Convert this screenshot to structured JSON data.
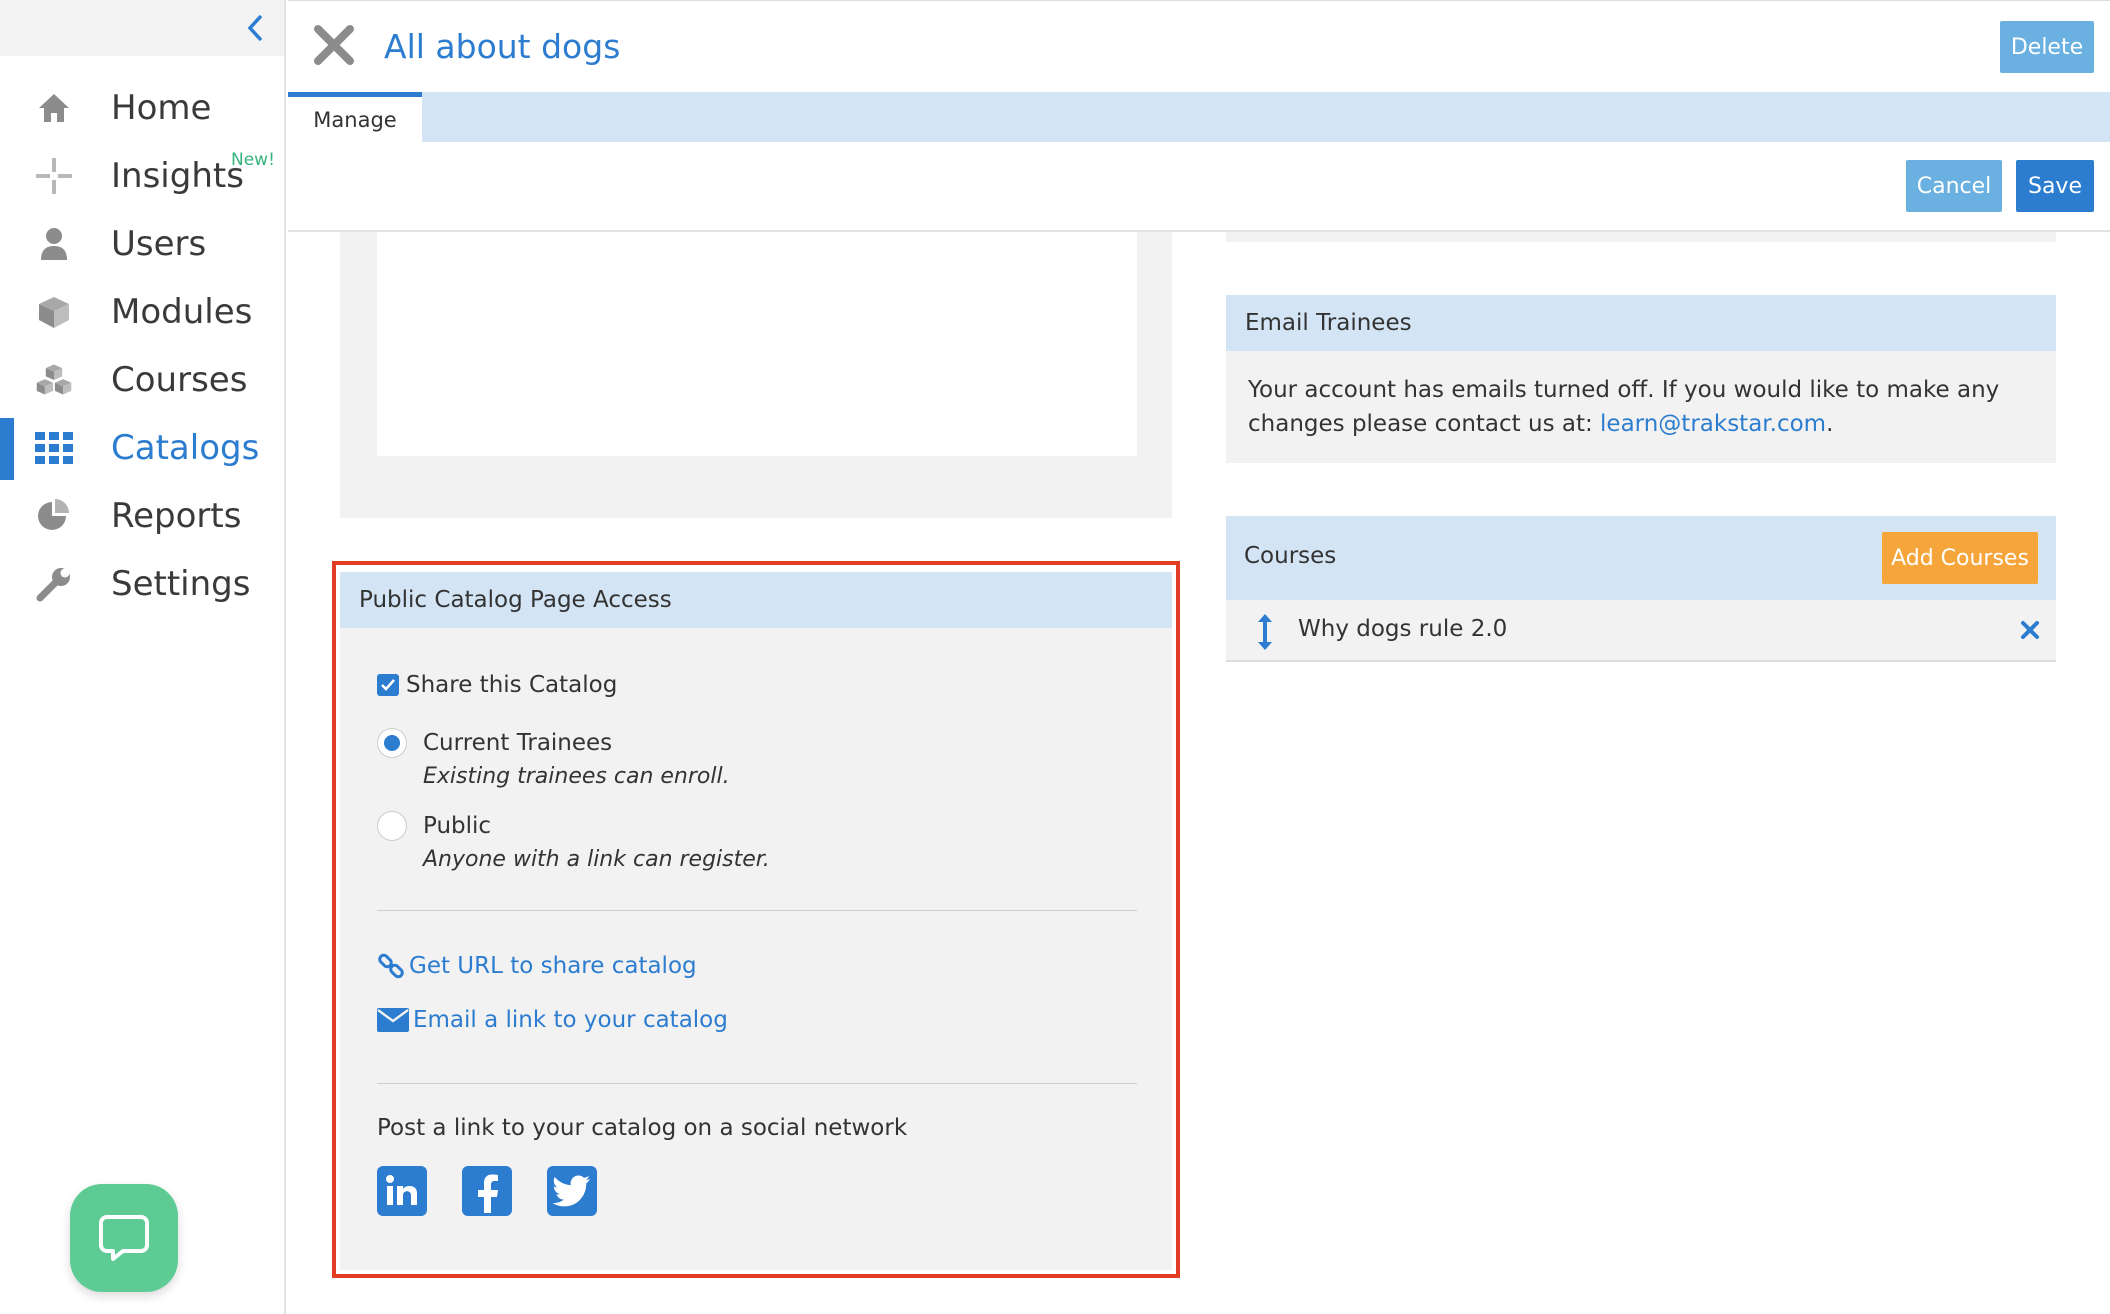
{
  "sidebar": {
    "collapse_icon": "chevron-left-icon",
    "items": [
      {
        "label": "Home",
        "icon": "home-icon"
      },
      {
        "label": "Insights",
        "icon": "insights-icon",
        "badge": "New!"
      },
      {
        "label": "Users",
        "icon": "user-icon"
      },
      {
        "label": "Modules",
        "icon": "cube-icon"
      },
      {
        "label": "Courses",
        "icon": "cubes-icon"
      },
      {
        "label": "Catalogs",
        "icon": "grid-icon",
        "active": true
      },
      {
        "label": "Reports",
        "icon": "pie-chart-icon"
      },
      {
        "label": "Settings",
        "icon": "wrench-icon"
      }
    ]
  },
  "header": {
    "title": "All about dogs",
    "delete_label": "Delete"
  },
  "tabs": [
    {
      "label": "Manage",
      "active": true
    }
  ],
  "actions": {
    "cancel_label": "Cancel",
    "save_label": "Save"
  },
  "access": {
    "heading": "Public Catalog Page Access",
    "share_label": "Share this Catalog",
    "share_checked": true,
    "options": [
      {
        "label": "Current Trainees",
        "description": "Existing trainees can enroll.",
        "selected": true
      },
      {
        "label": "Public",
        "description": "Anyone with a link can register.",
        "selected": false
      }
    ],
    "url_link": "Get URL to share catalog",
    "email_link": "Email a link to your catalog",
    "social_prompt": "Post a link to your catalog on a social network",
    "social": [
      "linkedin-icon",
      "facebook-icon",
      "twitter-icon"
    ]
  },
  "email_trainees": {
    "heading": "Email Trainees",
    "body_line1": "Your account has emails turned off. If you would like to make any",
    "body_line2_prefix": "changes please contact us at: ",
    "email": "learn@trakstar.com",
    "body_line2_suffix": "."
  },
  "courses": {
    "heading": "Courses",
    "add_label": "Add Courses",
    "items": [
      {
        "name": "Why dogs rule 2.0"
      }
    ]
  },
  "colors": {
    "accent": "#2c7ccf",
    "header_band": "#d3e4f4",
    "panel_bg": "#f2f2f2",
    "add_button": "#f5a53a",
    "highlight": "#e23d24",
    "chat": "#5ecb95"
  }
}
